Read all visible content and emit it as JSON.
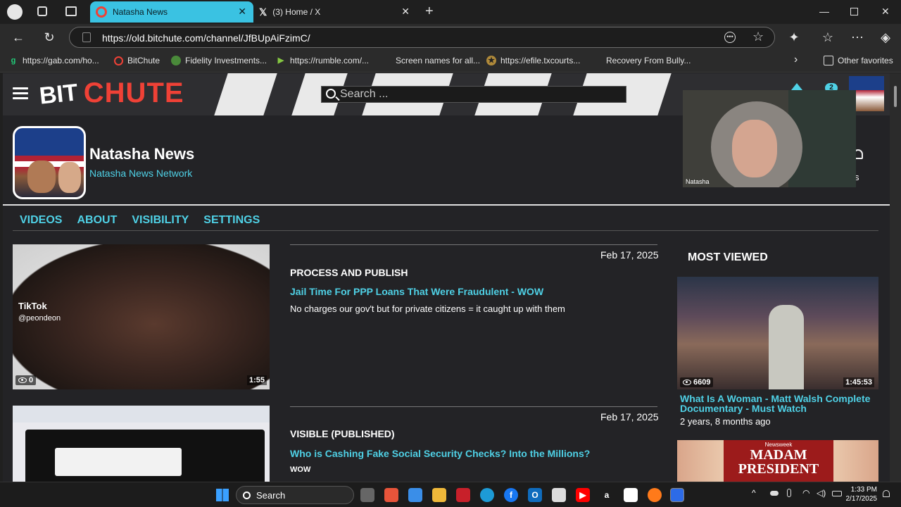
{
  "browser": {
    "tabs": [
      {
        "title": "Natasha News",
        "active": true
      },
      {
        "title": "(3) Home / X",
        "active": false
      }
    ],
    "url": "https://old.bitchute.com/channel/JfBUpAiFzimC/",
    "favorites": [
      "https://gab.com/ho...",
      "BitChute",
      "Fidelity Investments...",
      "https://rumble.com/...",
      "Screen names for all...",
      "https://efile.txcourts...",
      "Recovery From Bully..."
    ],
    "other_favorites": "Other favorites"
  },
  "site": {
    "logo_left": "BIT",
    "logo_right": "CHUTE",
    "search_placeholder": "Search ..."
  },
  "channel": {
    "name": "Natasha News",
    "subtitle": "Natasha News Network",
    "notification_count": "2"
  },
  "tabs": [
    "VIDEOS",
    "ABOUT",
    "VISIBILITY",
    "SETTINGS"
  ],
  "videos": [
    {
      "date": "Feb 17, 2025",
      "status": "PROCESS AND PUBLISH",
      "title": "Jail Time For PPP Loans That Were Fraudulent - WOW",
      "description": "No charges our gov't but for private citizens = it caught up with them",
      "views": "0",
      "duration": "1:55",
      "thumb_text": "TikTok",
      "thumb_handle": "@peondeon"
    },
    {
      "date": "Feb 17, 2025",
      "status": "VISIBLE (PUBLISHED)",
      "title": "Who is Cashing Fake Social Security Checks? Into the Millions?",
      "description": "wow"
    }
  ],
  "most_viewed": {
    "heading": "MOST VIEWED",
    "items": [
      {
        "title": "What Is A Woman - Matt Walsh Complete Documentary - Must Watch",
        "views": "6609",
        "duration": "1:45:53",
        "age": "2 years, 8 months ago"
      },
      {
        "thumb_text": "MADAM PRESIDENT",
        "thumb_kicker": "Newsweek"
      }
    ]
  },
  "webcam": {
    "label": "Natasha"
  },
  "taskbar": {
    "search": "Search",
    "time": "1:33 PM",
    "date": "2/17/2025"
  },
  "colors": {
    "accent": "#4fd1e6",
    "logo_red": "#ef4136",
    "tab_active": "#3ac2e2",
    "page_bg": "#232326"
  }
}
